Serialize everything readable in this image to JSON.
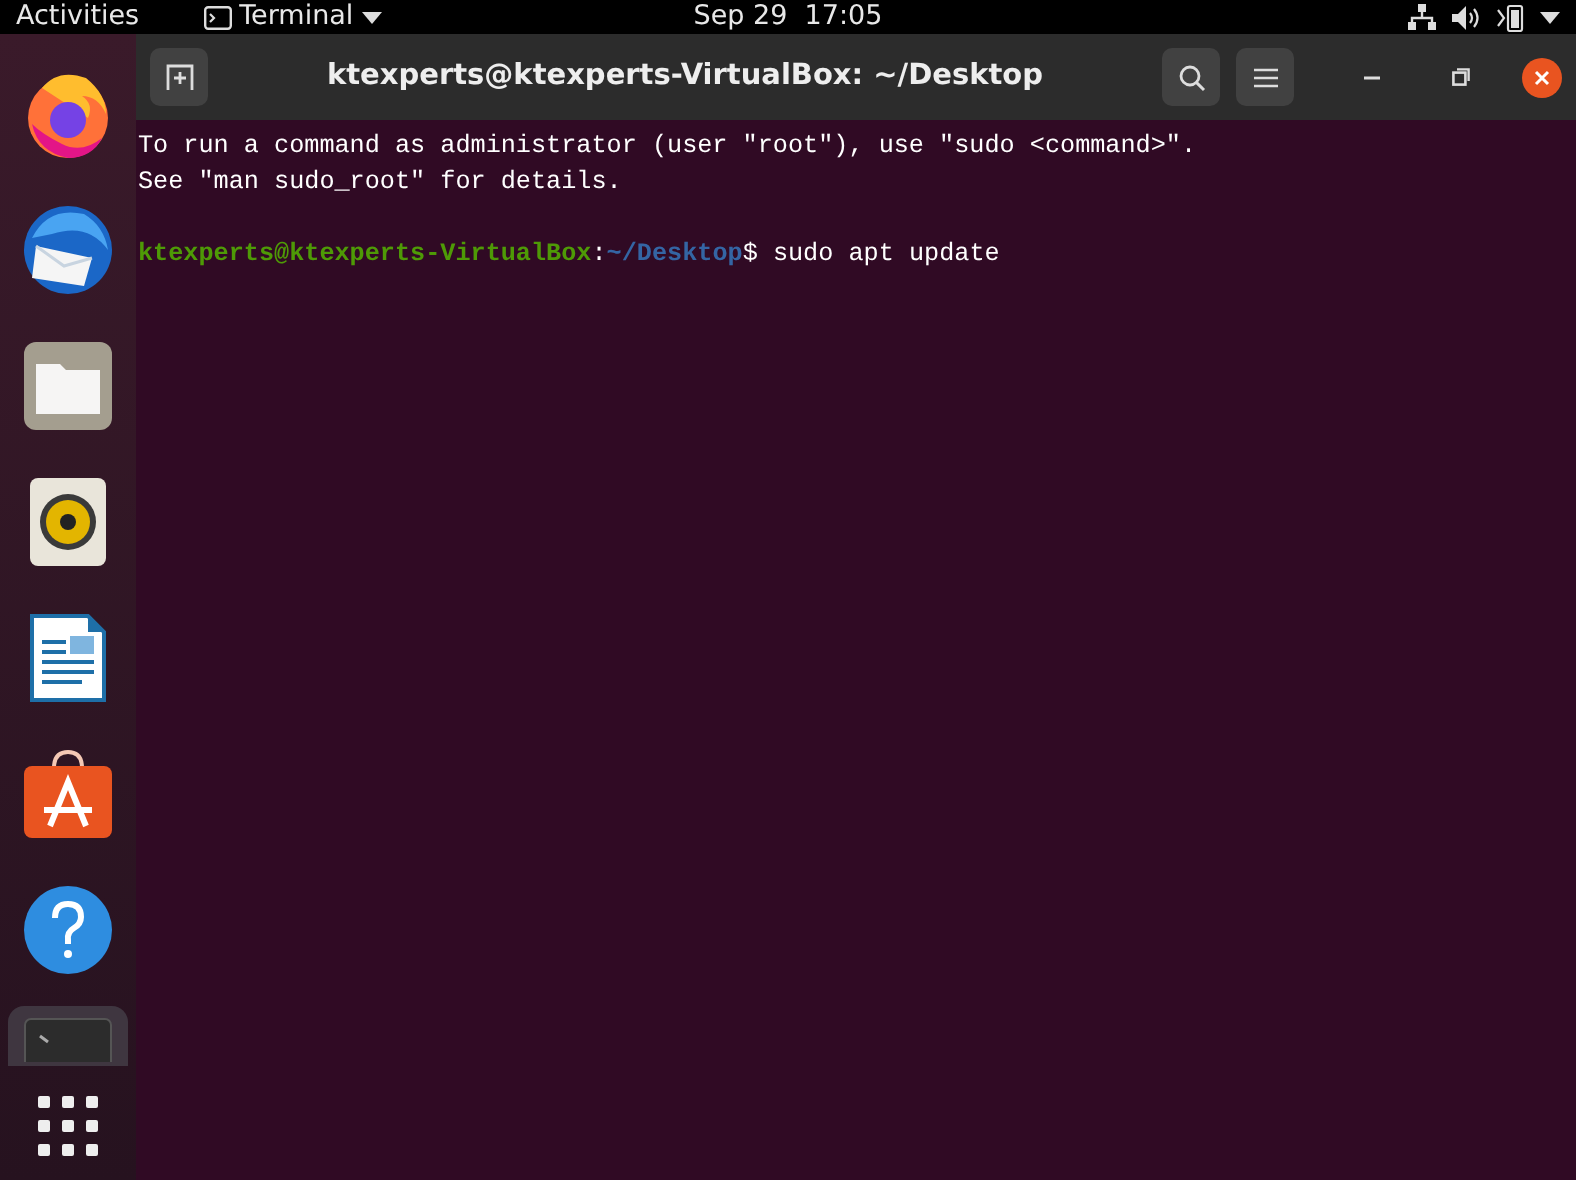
{
  "top_bar": {
    "activities": "Activities",
    "app_menu": "Terminal",
    "clock": "Sep 29  17:05"
  },
  "dock": [
    {
      "kind": "firefox",
      "selected": false
    },
    {
      "kind": "thunderbird",
      "selected": false
    },
    {
      "kind": "files",
      "selected": false
    },
    {
      "kind": "rhythmbox",
      "selected": false
    },
    {
      "kind": "writer",
      "selected": false
    },
    {
      "kind": "software",
      "selected": false
    },
    {
      "kind": "help",
      "selected": false
    },
    {
      "kind": "terminal",
      "selected": true
    },
    {
      "kind": "app-grid",
      "selected": false
    }
  ],
  "window": {
    "title": "ktexperts@ktexperts-VirtualBox: ~/Desktop"
  },
  "terminal": {
    "lines": [
      {
        "kind": "output",
        "text": "To run a command as administrator (user \"root\"), use \"sudo <command>\"."
      },
      {
        "kind": "output",
        "text": "See \"man sudo_root\" for details."
      },
      {
        "kind": "blank"
      },
      {
        "kind": "prompt",
        "user_host": "ktexperts@ktexperts-VirtualBox",
        "separator": ":",
        "path": "~/Desktop",
        "symbol": "$",
        "command": " sudo apt update"
      }
    ]
  }
}
